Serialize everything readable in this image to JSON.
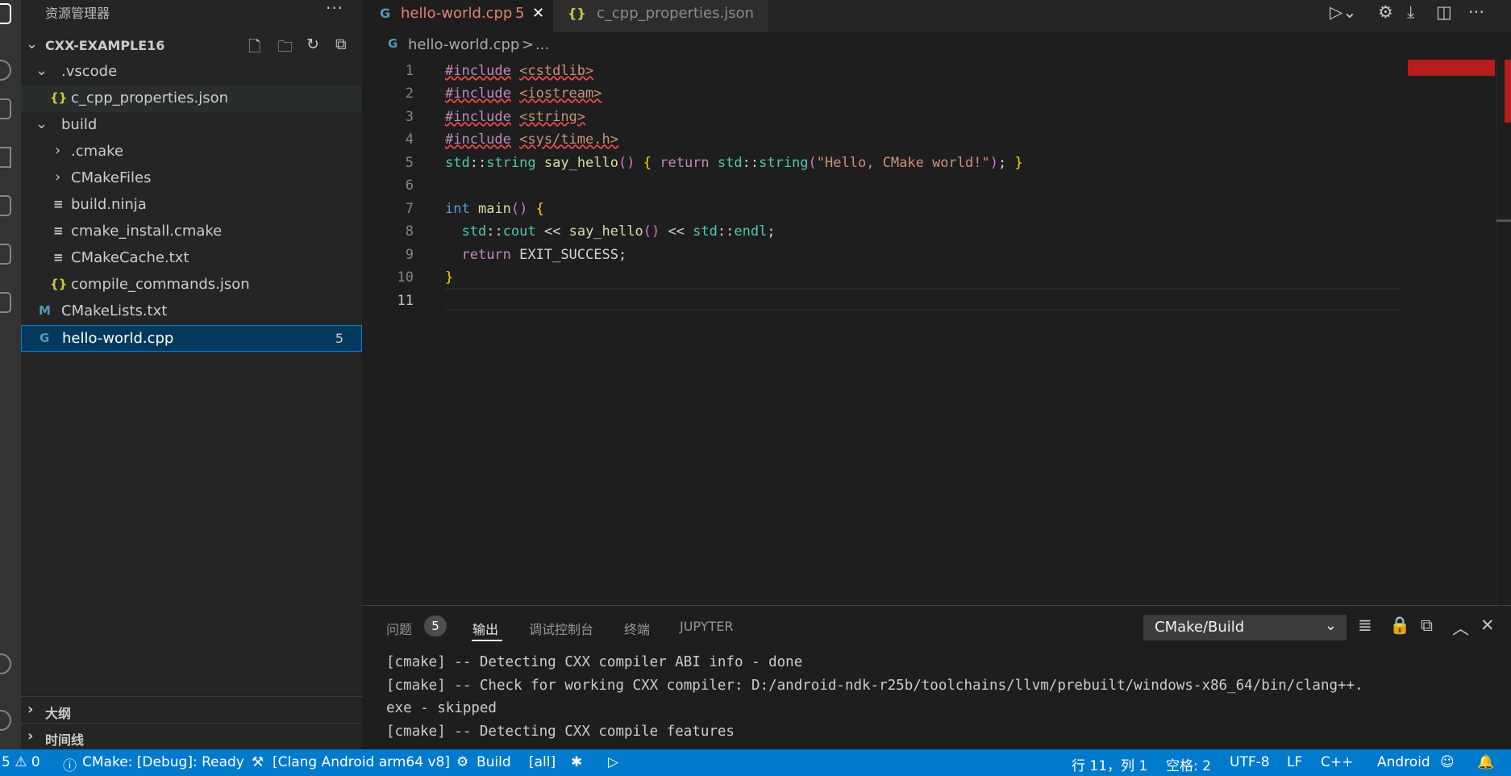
{
  "sidebar": {
    "title": "资源管理器",
    "more": "···",
    "root": "CXX-EXAMPLE16",
    "items": [
      {
        "label": ".vscode",
        "kind": "folder",
        "open": true
      },
      {
        "label": "c_cpp_properties.json",
        "kind": "json"
      },
      {
        "label": "build",
        "kind": "folder",
        "open": true
      },
      {
        "label": ".cmake",
        "kind": "folder",
        "open": false
      },
      {
        "label": "CMakeFiles",
        "kind": "folder",
        "open": false
      },
      {
        "label": "build.ninja",
        "kind": "text"
      },
      {
        "label": "cmake_install.cmake",
        "kind": "text"
      },
      {
        "label": "CMakeCache.txt",
        "kind": "text"
      },
      {
        "label": "compile_commands.json",
        "kind": "json"
      },
      {
        "label": "CMakeLists.txt",
        "kind": "cmake"
      },
      {
        "label": "hello-world.cpp",
        "kind": "cpp",
        "badge": "5"
      }
    ],
    "outline": "大纲",
    "timeline": "时间线"
  },
  "icons": {
    "json": "{}",
    "cpp": "G",
    "cmake": "M",
    "text": "≡",
    "folder_open": "⌄",
    "folder_closed": "›"
  },
  "tabs": [
    {
      "label": "hello-world.cpp",
      "badge": "5",
      "active": true
    },
    {
      "label": "c_cpp_properties.json",
      "active": false
    }
  ],
  "breadcrumb": {
    "file": "hello-world.cpp",
    "sep": ">",
    "rest": "..."
  },
  "editor": {
    "line_numbers": [
      "1",
      "2",
      "3",
      "4",
      "5",
      "6",
      "7",
      "8",
      "9",
      "10",
      "11"
    ],
    "current_line": "11"
  },
  "panel": {
    "tabs": {
      "problems": "问题",
      "problems_count": "5",
      "output": "输出",
      "debug_console": "调试控制台",
      "terminal": "终端",
      "jupyter": "JUPYTER"
    },
    "channel": "CMake/Build",
    "output_lines": [
      "[cmake] -- Detecting CXX compiler ABI info - done",
      "[cmake] -- Check for working CXX compiler: D:/android-ndk-r25b/toolchains/llvm/prebuilt/windows-x86_64/bin/clang++.",
      "exe - skipped",
      "[cmake] -- Detecting CXX compile features"
    ]
  },
  "status": {
    "problems_errors": "5",
    "problems_warnings": "0",
    "cmake_status": "CMake: [Debug]: Ready",
    "kit": "[Clang Android arm64 v8]",
    "build": "Build",
    "target": "[all]",
    "cursor": "行 11，列 1",
    "indent": "空格: 2",
    "encoding": "UTF-8",
    "eol": "LF",
    "language": "C++",
    "platform": "Android"
  },
  "colors": {
    "accent": "#007acc",
    "selection": "#04395e",
    "error": "#f14c4c",
    "tab_modified": "#e2826f"
  }
}
